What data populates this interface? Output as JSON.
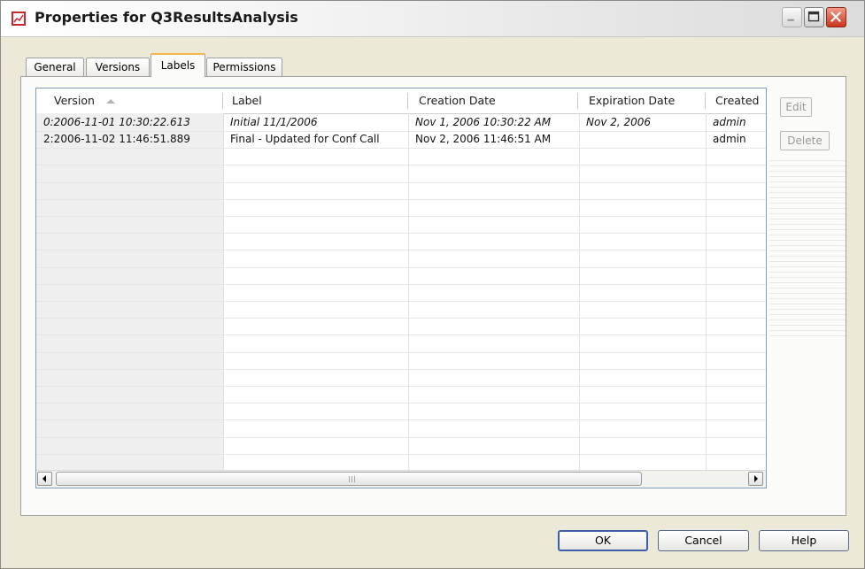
{
  "window": {
    "title": "Properties for Q3ResultsAnalysis",
    "icon": "chart-icon"
  },
  "tabs": [
    {
      "label": "General",
      "active": false
    },
    {
      "label": "Versions",
      "active": false
    },
    {
      "label": "Labels",
      "active": true
    },
    {
      "label": "Permissions",
      "active": false
    }
  ],
  "table": {
    "columns": [
      "Version",
      "Label",
      "Creation Date",
      "Expiration Date",
      "Created"
    ],
    "sort_column": "Version",
    "sort_direction": "ascending",
    "rows": [
      {
        "version": "0:2006-11-01 10:30:22.613",
        "label": "Initial 11/1/2006",
        "creation_date": "Nov 1, 2006 10:30:22 AM",
        "expiration_date": "Nov 2, 2006",
        "created": "admin",
        "italic": true
      },
      {
        "version": "2:2006-11-02 11:46:51.889",
        "label": "Final - Updated for Conf Call",
        "creation_date": "Nov 2, 2006 11:46:51 AM",
        "expiration_date": "",
        "created": "admin",
        "italic": false
      }
    ]
  },
  "side_buttons": {
    "edit": "Edit",
    "delete": "Delete"
  },
  "footer": {
    "ok": "OK",
    "cancel": "Cancel",
    "help": "Help"
  }
}
